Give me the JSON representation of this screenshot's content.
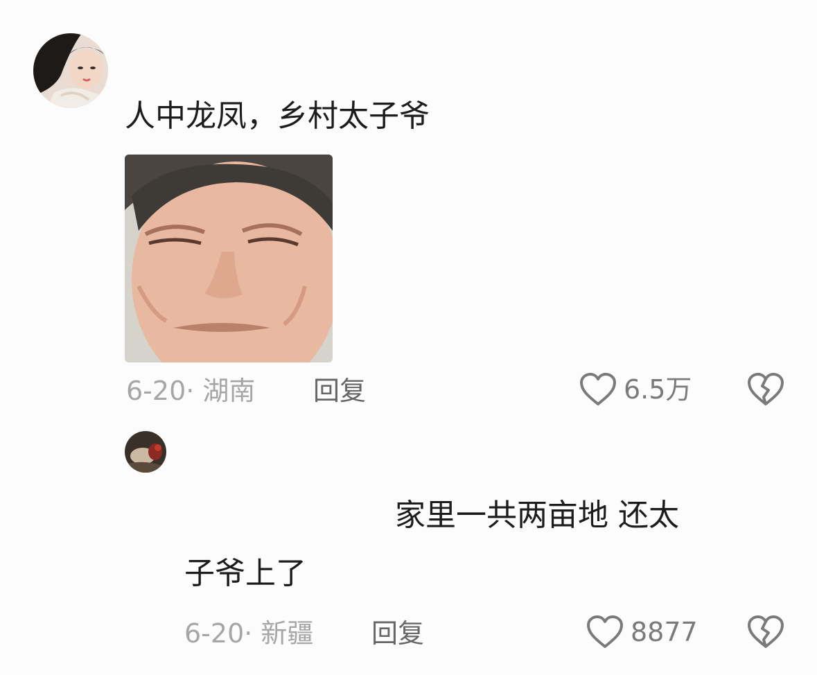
{
  "comments": [
    {
      "text": "人中龙凤，乡村太子爷",
      "sticker": "face-sticker",
      "date": "6-20",
      "location": "湖南",
      "reply_label": "回复",
      "likes": "6.5万"
    },
    {
      "text_line1": "家里一共两亩地 还太",
      "text_line2": "子爷上了",
      "date": "6-20",
      "location": "新疆",
      "reply_label": "回复",
      "likes": "8877"
    }
  ],
  "icons": {
    "like": "heart-icon",
    "dislike": "broken-heart-icon"
  },
  "colors": {
    "meta_gray": "#a6a6a6",
    "reply_gray": "#666666",
    "icon_gray": "#7a7a7a"
  }
}
